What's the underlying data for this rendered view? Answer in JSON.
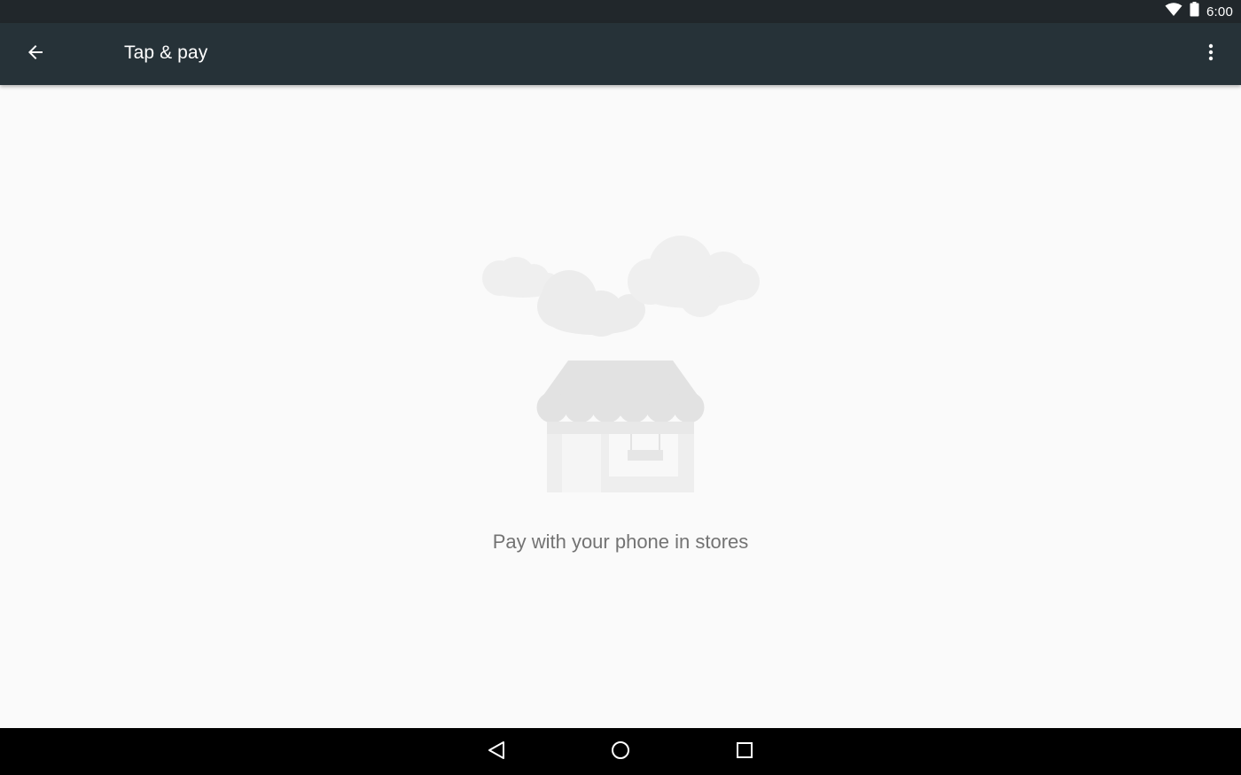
{
  "status_bar": {
    "time": "6:00",
    "icons": [
      "wifi-icon",
      "battery-icon"
    ]
  },
  "app_bar": {
    "title": "Tap & pay",
    "back_icon": "arrow-back-icon",
    "overflow_icon": "more-vert-icon"
  },
  "main": {
    "illustration": "storefront-with-clouds",
    "message": "Pay with your phone in stores"
  },
  "nav_bar": {
    "buttons": [
      "back-triangle-icon",
      "home-circle-icon",
      "recents-square-icon"
    ]
  },
  "colors": {
    "status_bar": "#21272b",
    "app_bar": "#263238",
    "background": "#fafafa",
    "text_secondary": "#737373",
    "nav_bar": "#000000"
  }
}
